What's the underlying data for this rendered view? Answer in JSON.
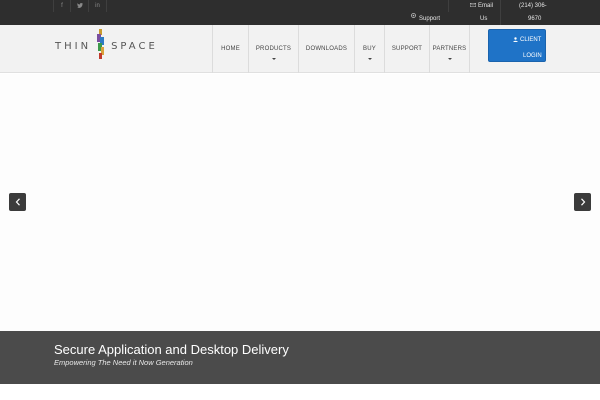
{
  "topbar": {
    "social": [
      {
        "icon": "facebook-icon",
        "glyph": "f"
      },
      {
        "icon": "twitter-icon",
        "glyph": "t"
      },
      {
        "icon": "linkedin-icon",
        "glyph": "in"
      }
    ],
    "email_label": "Email",
    "support_label": "Support",
    "support_label_2": "Us",
    "phone_line_1": "(214) 306-",
    "phone_line_2": "9670"
  },
  "header": {
    "logo_left": "THIN",
    "logo_right": "SPACE",
    "nav": [
      {
        "label": "Home",
        "dropdown": false
      },
      {
        "label": "Products",
        "dropdown": true
      },
      {
        "label": "Downloads",
        "dropdown": false
      },
      {
        "label": "Buy",
        "dropdown": true
      },
      {
        "label": "Support",
        "dropdown": false
      },
      {
        "label": "Partners",
        "dropdown": true
      }
    ],
    "client_login_line_1": "Client",
    "client_login_line_2": "Login"
  },
  "slider": {
    "caption_title": "Secure Application and Desktop Delivery",
    "caption_subtitle": "Empowering The Need it Now Generation"
  },
  "colors": {
    "topbar_bg": "#2e2e2e",
    "header_bg": "#f2f2f2",
    "accent_button": "#1f73c7",
    "caption_bg": "#4b4b4b"
  }
}
